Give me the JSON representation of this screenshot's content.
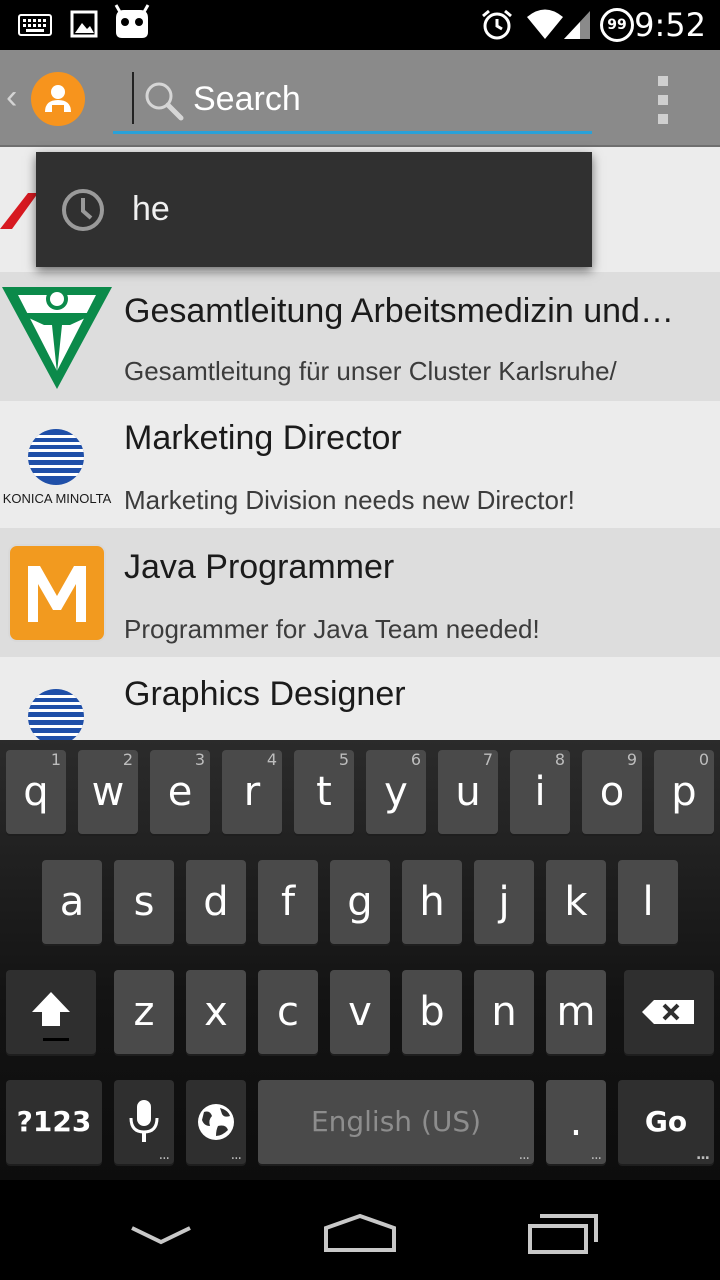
{
  "status_bar": {
    "time": "9:52",
    "notification_badge": "99",
    "icons": [
      "keyboard-icon",
      "image-icon",
      "android-icon",
      "alarm-icon",
      "wifi-icon",
      "signal-icon",
      "notification-count-icon"
    ]
  },
  "action_bar": {
    "search": {
      "placeholder": "Search",
      "value": ""
    },
    "colors": {
      "background": "#8a8a8a",
      "underline": "#2aa1d8",
      "avatar": "#f7941d"
    }
  },
  "suggestion": {
    "text": "he",
    "icon": "history-clock-icon"
  },
  "list": {
    "items": [
      {
        "title": "",
        "subtitle": "",
        "logo": "red-partial-logo"
      },
      {
        "title": "Gesamtleitung Arbeitsmedizin und…",
        "subtitle": "Gesamtleitung für unser Cluster Karlsruhe/",
        "logo": "green-figure-logo"
      },
      {
        "title": "Marketing Director",
        "subtitle": "Marketing Division needs new Director!",
        "logo": "konica-minolta-logo",
        "logo_text": "KONICA MINOLTA"
      },
      {
        "title": "Java Programmer",
        "subtitle": "Programmer for Java Team needed!",
        "logo": "orange-m-logo"
      },
      {
        "title": "Graphics Designer",
        "subtitle": "",
        "logo": "konica-minolta-logo"
      }
    ]
  },
  "keyboard": {
    "row1": [
      {
        "k": "q",
        "h": "1"
      },
      {
        "k": "w",
        "h": "2"
      },
      {
        "k": "e",
        "h": "3"
      },
      {
        "k": "r",
        "h": "4"
      },
      {
        "k": "t",
        "h": "5"
      },
      {
        "k": "y",
        "h": "6"
      },
      {
        "k": "u",
        "h": "7"
      },
      {
        "k": "i",
        "h": "8"
      },
      {
        "k": "o",
        "h": "9"
      },
      {
        "k": "p",
        "h": "0"
      }
    ],
    "row2": [
      "a",
      "s",
      "d",
      "f",
      "g",
      "h",
      "j",
      "k",
      "l"
    ],
    "row3": [
      "z",
      "x",
      "c",
      "v",
      "b",
      "n",
      "m"
    ],
    "symbols_label": "?123",
    "space_label": "English (US)",
    "period_label": ".",
    "go_label": "Go",
    "more_dots": "..."
  }
}
